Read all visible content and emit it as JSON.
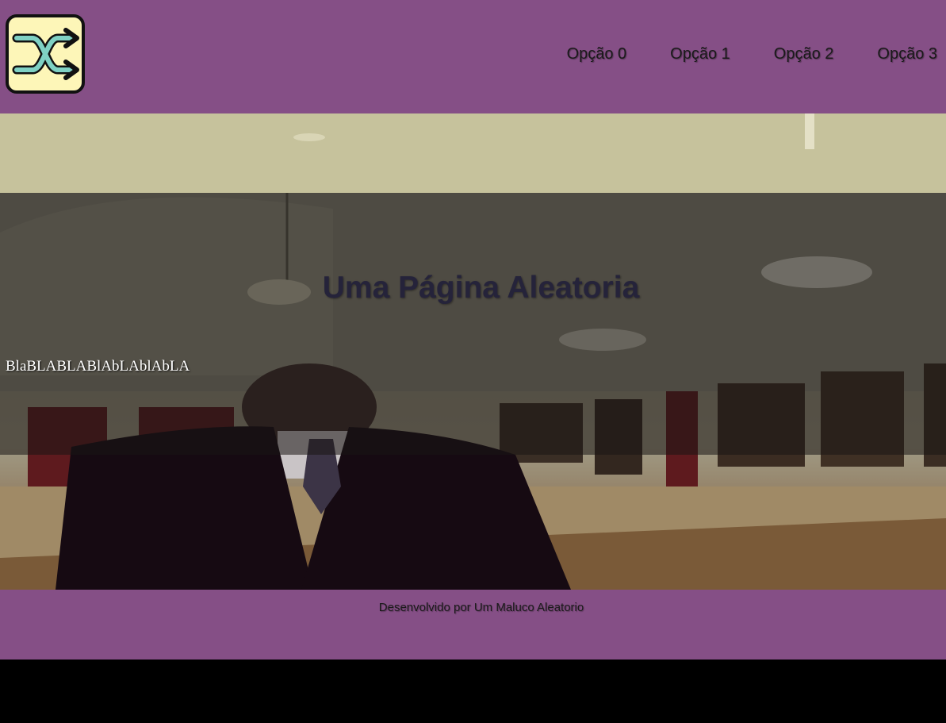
{
  "header": {
    "logo_icon": "shuffle-icon",
    "nav": [
      {
        "label": "Opção 0"
      },
      {
        "label": "Opção 1"
      },
      {
        "label": "Opção 2"
      },
      {
        "label": "Opção 3"
      }
    ]
  },
  "hero": {
    "title": "Uma Página Aleatoria",
    "text": "BlaBLABLABlAbLAblAbLA"
  },
  "footer": {
    "credit": "Desenvolvido por Um Maluco Aleatorio"
  },
  "colors": {
    "header_bg": "#854f86",
    "footer_bg": "#854f86",
    "logo_bg": "#fdf6b8",
    "logo_arrows": "#7fd1c4",
    "title": "#25233a"
  }
}
